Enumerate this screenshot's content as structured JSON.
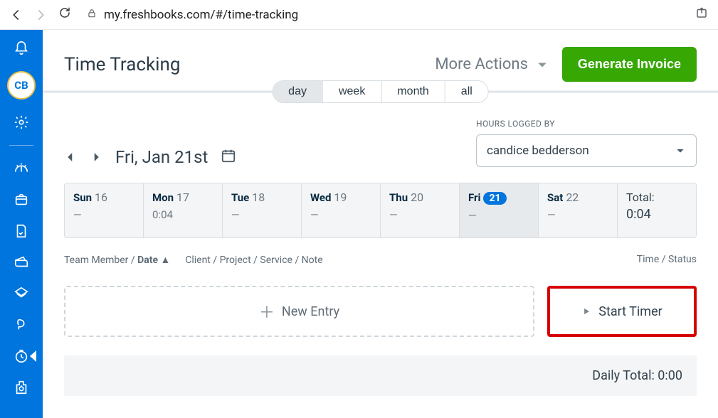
{
  "browser": {
    "url": "my.freshbooks.com/#/time-tracking"
  },
  "sidebar": {
    "avatar_initials": "CB"
  },
  "header": {
    "title": "Time Tracking",
    "more_actions": "More Actions",
    "generate_invoice": "Generate Invoice"
  },
  "seg": {
    "day": "day",
    "week": "week",
    "month": "month",
    "all": "all"
  },
  "dateNav": {
    "label": "Fri, Jan 21st"
  },
  "filter": {
    "label": "HOURS LOGGED BY",
    "value": "candice bedderson"
  },
  "week": {
    "days": [
      {
        "name": "Sun",
        "num": "16",
        "val": "—"
      },
      {
        "name": "Mon",
        "num": "17",
        "val": "0:04"
      },
      {
        "name": "Tue",
        "num": "18",
        "val": "—"
      },
      {
        "name": "Wed",
        "num": "19",
        "val": "—"
      },
      {
        "name": "Thu",
        "num": "20",
        "val": "—"
      },
      {
        "name": "Fri",
        "num": "21",
        "val": "—"
      },
      {
        "name": "Sat",
        "num": "22",
        "val": "—"
      }
    ],
    "total_label": "Total:",
    "total_value": "0:04"
  },
  "thead": {
    "left_pre": "Team Member / ",
    "left_bold": "Date",
    "middle": "Client / Project / Service / Note",
    "right": "Time / Status"
  },
  "entry": {
    "new_entry": "New Entry",
    "start_timer": "Start Timer"
  },
  "footer": {
    "label": "Daily Total: ",
    "value": "0:00"
  }
}
